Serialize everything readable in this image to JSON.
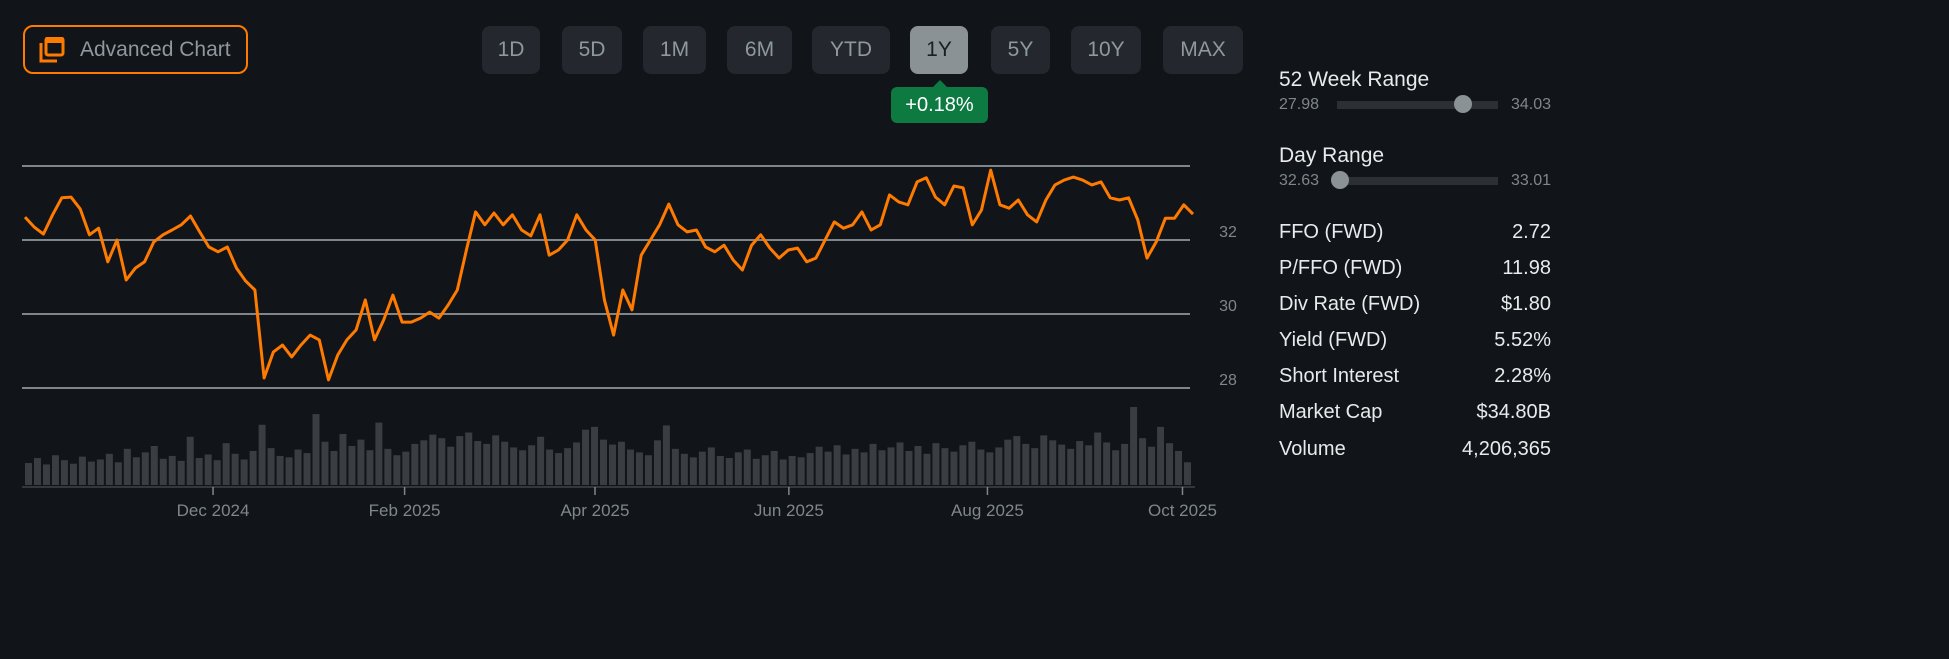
{
  "toolbar": {
    "advanced_chart_label": "Advanced Chart",
    "ranges": [
      "1D",
      "5D",
      "1M",
      "6M",
      "YTD",
      "1Y",
      "5Y",
      "10Y",
      "MAX"
    ],
    "active_range": "1Y",
    "change_badge": "+0.18%"
  },
  "colors": {
    "line": "#ff7a00",
    "badge": "#0d7a41",
    "volume": "#3a3e43",
    "grid": "#7f8689"
  },
  "side": {
    "week52": {
      "label": "52 Week Range",
      "low": "27.98",
      "high": "34.03",
      "position": 0.78
    },
    "day": {
      "label": "Day Range",
      "low": "32.63",
      "high": "33.01",
      "position": 0.02
    },
    "stats": [
      {
        "label": "FFO (FWD)",
        "value": "2.72"
      },
      {
        "label": "P/FFO (FWD)",
        "value": "11.98"
      },
      {
        "label": "Div Rate (FWD)",
        "value": "$1.80"
      },
      {
        "label": "Yield (FWD)",
        "value": "5.52%"
      },
      {
        "label": "Short Interest",
        "value": "2.28%"
      },
      {
        "label": "Market Cap",
        "value": "$34.80B"
      },
      {
        "label": "Volume",
        "value": "4,206,365"
      }
    ]
  },
  "chart_data": {
    "type": "line",
    "ylim": [
      28,
      34
    ],
    "yticks": [
      {
        "v": 28,
        "label": "28"
      },
      {
        "v": 30,
        "label": "30"
      },
      {
        "v": 32,
        "label": "32"
      },
      {
        "v": 34,
        "label": ""
      }
    ],
    "xticks": [
      {
        "f": 0.161,
        "label": "Dec 2024"
      },
      {
        "f": 0.325,
        "label": "Feb 2025"
      },
      {
        "f": 0.488,
        "label": "Apr 2025"
      },
      {
        "f": 0.654,
        "label": "Jun 2025"
      },
      {
        "f": 0.824,
        "label": "Aug 2025"
      },
      {
        "f": 0.991,
        "label": "Oct 2025"
      }
    ],
    "price": [
      32.62,
      32.35,
      32.16,
      32.68,
      33.14,
      33.16,
      32.84,
      32.14,
      32.32,
      31.41,
      32.0,
      30.92,
      31.24,
      31.41,
      31.95,
      32.14,
      32.27,
      32.41,
      32.65,
      32.22,
      31.81,
      31.68,
      31.81,
      31.24,
      30.89,
      30.65,
      28.27,
      28.97,
      29.16,
      28.84,
      29.16,
      29.43,
      29.3,
      28.22,
      28.89,
      29.3,
      29.57,
      30.38,
      29.3,
      29.84,
      30.51,
      29.78,
      29.78,
      29.89,
      30.05,
      29.89,
      30.24,
      30.65,
      31.73,
      32.76,
      32.41,
      32.73,
      32.41,
      32.68,
      32.27,
      32.11,
      32.68,
      31.59,
      31.73,
      32.0,
      32.68,
      32.27,
      32.0,
      30.38,
      29.43,
      30.65,
      30.11,
      31.59,
      32.0,
      32.41,
      32.97,
      32.41,
      32.22,
      32.27,
      31.81,
      31.68,
      31.86,
      31.46,
      31.19,
      31.86,
      32.14,
      31.78,
      31.51,
      31.73,
      31.78,
      31.41,
      31.51,
      32.0,
      32.49,
      32.32,
      32.41,
      32.76,
      32.27,
      32.41,
      33.22,
      33.03,
      32.95,
      33.57,
      33.68,
      33.16,
      32.95,
      33.46,
      33.41,
      32.41,
      32.81,
      33.89,
      32.95,
      32.86,
      33.08,
      32.68,
      32.49,
      33.08,
      33.49,
      33.62,
      33.7,
      33.62,
      33.49,
      33.57,
      33.14,
      33.08,
      33.14,
      32.54,
      31.51,
      31.95,
      32.59,
      32.59,
      32.95,
      32.7
    ],
    "volume_millions": [
      3.1,
      3.8,
      2.9,
      4.2,
      3.5,
      3.0,
      4.0,
      3.3,
      3.6,
      4.4,
      3.2,
      5.1,
      3.9,
      4.6,
      5.5,
      3.7,
      4.1,
      3.4,
      6.8,
      3.8,
      4.3,
      3.5,
      5.9,
      4.4,
      3.6,
      4.8,
      8.5,
      5.2,
      4.1,
      3.9,
      5.0,
      4.5,
      10.0,
      6.1,
      4.8,
      7.2,
      5.5,
      6.4,
      4.9,
      8.8,
      5.1,
      4.2,
      4.7,
      5.8,
      6.3,
      7.1,
      6.6,
      5.4,
      6.9,
      7.4,
      6.2,
      5.8,
      7.0,
      6.1,
      5.3,
      4.9,
      5.6,
      6.8,
      5.0,
      4.5,
      5.2,
      6.0,
      7.8,
      8.2,
      6.4,
      5.7,
      6.1,
      5.0,
      4.6,
      4.2,
      6.3,
      8.4,
      5.1,
      4.4,
      3.9,
      4.7,
      5.3,
      4.1,
      3.8,
      4.6,
      5.0,
      3.7,
      4.2,
      4.8,
      3.6,
      4.1,
      3.9,
      4.5,
      5.4,
      4.7,
      5.6,
      4.3,
      5.1,
      4.6,
      5.8,
      4.9,
      5.3,
      6.0,
      4.8,
      5.5,
      4.4,
      5.9,
      5.2,
      4.7,
      5.6,
      6.1,
      5.0,
      4.6,
      5.3,
      6.4,
      6.9,
      5.8,
      5.2,
      7.0,
      6.3,
      5.7,
      5.1,
      6.2,
      5.6,
      7.4,
      6.0,
      4.9,
      5.8,
      11.0,
      6.6,
      5.4,
      8.2,
      5.9,
      4.8,
      3.2
    ]
  }
}
